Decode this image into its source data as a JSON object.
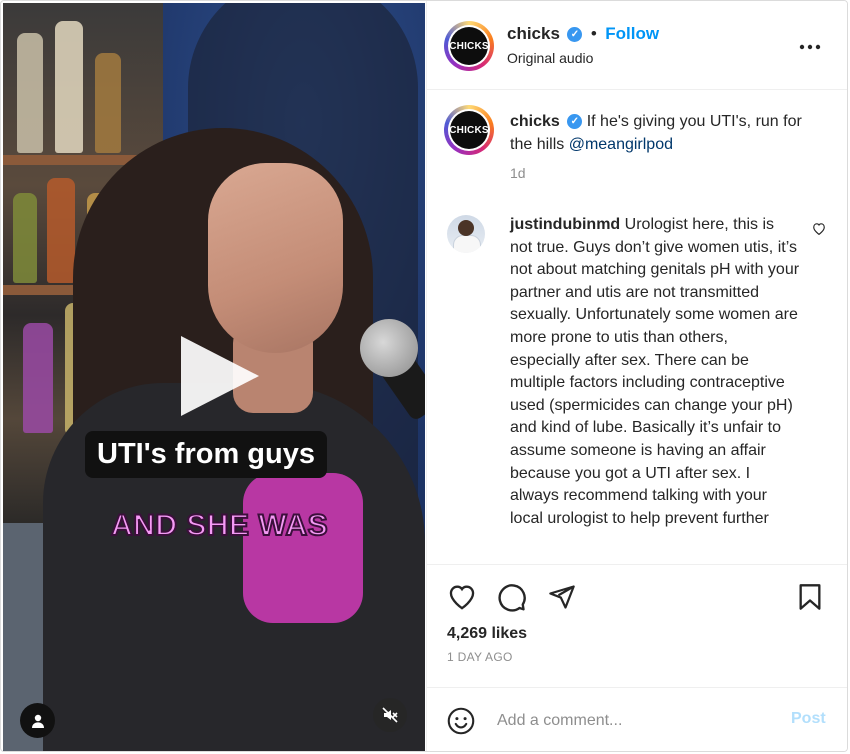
{
  "media": {
    "caption_line1": "UTI's from guys",
    "caption_line2": "AND SHE WAS",
    "play_icon": "play-icon",
    "tagged_users_icon": "user-icon",
    "mute_icon": "speaker-muted-icon"
  },
  "header": {
    "username": "chicks",
    "avatar_text": "CHICKS",
    "verified_icon": "verified-badge-icon",
    "separator": "•",
    "follow_label": "Follow",
    "subtitle": "Original audio",
    "more_icon": "more-options-icon"
  },
  "caption": {
    "username": "chicks",
    "text": "If he's giving you UTI's, run for the hills",
    "mention": "@meangirlpod",
    "time": "1d"
  },
  "comment": {
    "username": "justindubinmd",
    "text": "Urologist here, this is not true. Guys don’t give women utis, it’s not about matching genitals pH with your partner and utis are not transmitted sexually. Unfortunately some women are more prone to utis than others, especially after sex. There can be multiple factors including contraceptive used (spermicides can change your pH) and kind of lube. Basically it’s unfair to assume someone is having an affair because you got a UTI after sex. I always recommend talking with your local urologist to help prevent further"
  },
  "actions": {
    "like_icon": "heart-icon",
    "comment_icon": "comment-icon",
    "share_icon": "share-icon",
    "save_icon": "bookmark-icon",
    "likes": "4,269 likes",
    "time_ago": "1 DAY AGO"
  },
  "add_comment": {
    "emoji_icon": "emoji-icon",
    "placeholder": "Add a comment...",
    "post_label": "Post"
  },
  "colors": {
    "accent": "#0095f6",
    "link": "#00376b",
    "muted": "#8e8e8e",
    "post_disabled": "#b2dffc"
  }
}
